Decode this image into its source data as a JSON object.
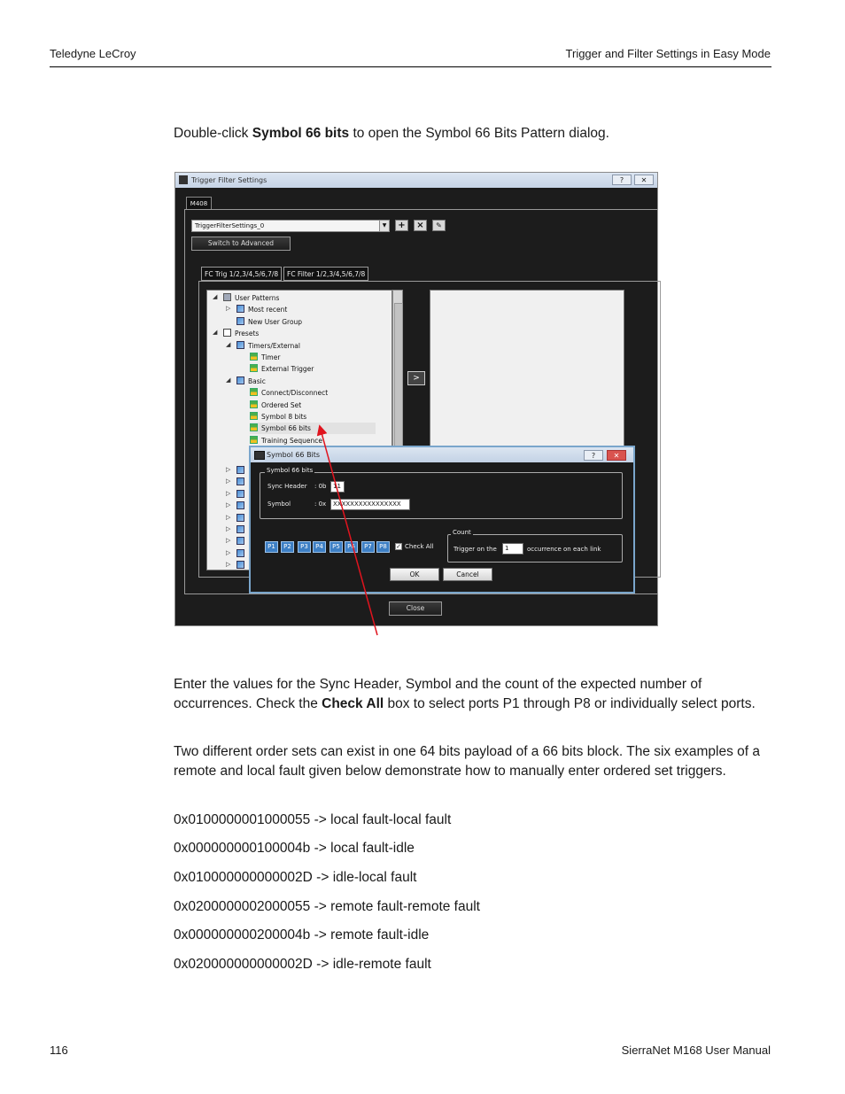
{
  "header": {
    "left": "Teledyne LeCroy",
    "right": "Trigger and Filter Settings in Easy Mode"
  },
  "intro": {
    "before": "Double-click ",
    "bold": "Symbol 66 bits",
    "after": " to open the Symbol 66 Bits Pattern dialog."
  },
  "window": {
    "title": "Trigger Filter Settings",
    "help_btn": "?",
    "close_btn": "✕",
    "device_tab": "M408",
    "settings_combo": "TriggerFilterSettings_0",
    "switch_button": "Switch to Advanced",
    "tabs": [
      "FC Trig 1/2,3/4,5/6,7/8",
      "FC Filter 1/2,3/4,5/6,7/8"
    ],
    "tree": [
      {
        "label": "User Patterns",
        "level": 0,
        "icon": "user-icon",
        "expander": "◢"
      },
      {
        "label": "Most recent",
        "level": 1,
        "icon": "group-icon",
        "expander": "▷"
      },
      {
        "label": "New User Group",
        "level": 1,
        "icon": "group-icon",
        "expander": ""
      },
      {
        "label": "Presets",
        "level": 0,
        "icon": "list-icon",
        "expander": "◢"
      },
      {
        "label": "Timers/External",
        "level": 1,
        "icon": "group-icon",
        "expander": "◢"
      },
      {
        "label": "Timer",
        "level": 2,
        "icon": "leaf-icon",
        "expander": ""
      },
      {
        "label": "External Trigger",
        "level": 2,
        "icon": "leaf-icon",
        "expander": ""
      },
      {
        "label": "Basic",
        "level": 1,
        "icon": "group-icon",
        "expander": "◢"
      },
      {
        "label": "Connect/Disconnect",
        "level": 2,
        "icon": "leaf-icon",
        "expander": ""
      },
      {
        "label": "Ordered Set",
        "level": 2,
        "icon": "leaf-icon",
        "expander": ""
      },
      {
        "label": "Symbol 8 bits",
        "level": 2,
        "icon": "leaf-icon",
        "expander": ""
      },
      {
        "label": "Symbol 66 bits",
        "level": 2,
        "icon": "leaf-icon",
        "expander": "",
        "selected": true
      },
      {
        "label": "Training Sequence",
        "level": 2,
        "icon": "leaf-icon",
        "expander": ""
      }
    ],
    "move_button": ">",
    "close_button": "Close"
  },
  "dialog": {
    "title": "Symbol 66 Bits",
    "help_btn": "?",
    "close_btn": "✕",
    "group_label": "Symbol 66 bits",
    "sync_header_label": "Sync Header",
    "sync_prefix": ": 0b",
    "sync_value": "11",
    "symbol_label": "Symbol",
    "symbol_prefix": ": 0x",
    "symbol_value": "XXXXXXXXXXXXXXXX",
    "ports": [
      "P1",
      "P2",
      "P3",
      "P4",
      "P5",
      "P6",
      "P7",
      "P8"
    ],
    "check_all_label": "Check All",
    "count_group_label": "Count",
    "trigger_on_label": "Trigger on the",
    "count_value": "1",
    "occurrence_label": "occurrence on each link",
    "ok_button": "OK",
    "cancel_button": "Cancel"
  },
  "colors": {
    "annotation_arrow": "#e0141e",
    "port_blue": "#3d7fc4"
  },
  "body": {
    "para1_a": "Enter the values for the Sync Header, Symbol and the count of the expected number of occurrences. Check the ",
    "para1_bold": "Check All",
    "para1_b": " box to select ports P1 through P8 or individually select ports.",
    "para2": "Two different order sets can exist in one 64 bits payload of a 66 bits block. The six examples of a remote and local fault given below demonstrate how to manually enter ordered set triggers.",
    "examples": [
      "0x0100000001000055 -> local fault-local fault",
      "0x000000000100004b -> local fault-idle",
      "0x010000000000002D -> idle-local fault",
      "0x0200000002000055 -> remote fault-remote fault",
      "0x000000000200004b -> remote fault-idle",
      "0x020000000000002D -> idle-remote fault"
    ]
  },
  "footer": {
    "page_number": "116",
    "manual": "SierraNet M168 User Manual"
  }
}
